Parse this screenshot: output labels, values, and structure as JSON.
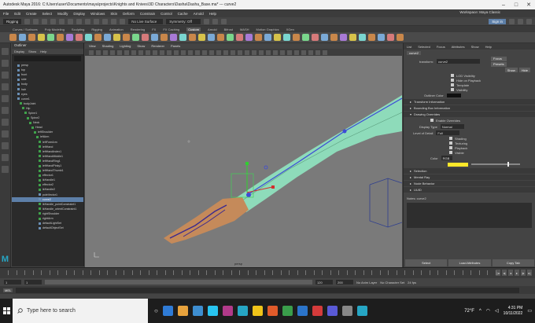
{
  "window": {
    "title": "Autodesk Maya 2016: C:\\Users\\user\\Documents\\maya\\projects\\Knights and Knives\\3D Characters\\Dasha\\Dasha_Base.ma* --- curve2",
    "controls": [
      "–",
      "□",
      "✕"
    ]
  },
  "menubar": {
    "items": [
      "File",
      "Edit",
      "Create",
      "Select",
      "Modify",
      "Display",
      "Windows",
      "Skin",
      "Deform",
      "Constrain",
      "Control",
      "Cache",
      "Arnold",
      "Help"
    ],
    "workspace": "Workspace: Maya Classic"
  },
  "statusline": {
    "menu_set": "Rigging",
    "search_value": "No Live Surface",
    "symmetry": "Symmetry: Off",
    "sign_in": "Sign in"
  },
  "shelf_tabs": {
    "items": [
      "Curves / Surfaces",
      "Poly Modeling",
      "Sculpting",
      "Rigging",
      "Animation",
      "Rendering",
      "FX",
      "FX Caching",
      "Custom",
      "Arnold",
      "Bifrost",
      "MASH",
      "Motion Graphics",
      "XGen"
    ],
    "active_index": 8
  },
  "outliner": {
    "title": "Outliner",
    "menu": [
      "Display",
      "Show",
      "Help"
    ],
    "items": [
      {
        "label": "persp",
        "type": "cam"
      },
      {
        "label": "top",
        "type": "cam"
      },
      {
        "label": "front",
        "type": "cam"
      },
      {
        "label": "side",
        "type": "cam"
      },
      {
        "label": "body",
        "type": "mesh"
      },
      {
        "label": "hair",
        "type": "mesh"
      },
      {
        "label": "eyes",
        "type": "mesh"
      },
      {
        "label": "curve1",
        "type": "mesh"
      },
      {
        "label": "bodyJoint",
        "type": "joint"
      },
      {
        "label": "Hip",
        "type": "joint"
      },
      {
        "label": "Spine1",
        "type": "joint"
      },
      {
        "label": "Spine2",
        "type": "joint"
      },
      {
        "label": "Neck",
        "type": "joint"
      },
      {
        "label": "Head",
        "type": "joint"
      },
      {
        "label": "leftShoulder",
        "type": "joint"
      },
      {
        "label": "leftArm",
        "type": "joint"
      },
      {
        "label": "leftForeArm",
        "type": "joint"
      },
      {
        "label": "leftHand",
        "type": "joint"
      },
      {
        "label": "leftHandIndex1",
        "type": "joint"
      },
      {
        "label": "leftHandMiddle1",
        "type": "joint"
      },
      {
        "label": "leftHandRing1",
        "type": "joint"
      },
      {
        "label": "leftHandPinky1",
        "type": "joint"
      },
      {
        "label": "leftHandThumb1",
        "type": "joint"
      },
      {
        "label": "effector1",
        "type": "joint"
      },
      {
        "label": "ikHandle1",
        "type": "joint"
      },
      {
        "label": "effector2",
        "type": "joint"
      },
      {
        "label": "ikHandle2",
        "type": "joint"
      },
      {
        "label": "poleVector1",
        "type": "mesh"
      },
      {
        "label": "curve2",
        "type": "mesh"
      },
      {
        "label": "ikHandle_pointConstraint1",
        "type": "joint"
      },
      {
        "label": "ikHandle_orientConstraint1",
        "type": "joint"
      },
      {
        "label": "rightShoulder",
        "type": "joint"
      },
      {
        "label": "rightArm",
        "type": "joint"
      },
      {
        "label": "defaultLightSet",
        "type": "mesh"
      },
      {
        "label": "defaultObjectSet",
        "type": "mesh"
      }
    ],
    "selected_index": 28
  },
  "viewport": {
    "menu": [
      "View",
      "Shading",
      "Lighting",
      "Show",
      "Renderer",
      "Panels"
    ],
    "camera_label": "persp",
    "joint_color": "#3d4bd6",
    "mesh_color": "#8fe3bf",
    "hand_color": "#c58a5a"
  },
  "attribute_editor": {
    "tabs": [
      "List",
      "Selected",
      "Focus",
      "Attributes",
      "Show",
      "Help"
    ],
    "node_tab": "curve2",
    "transform_label": "transform:",
    "transform_value": "curve2",
    "focus_button": "Focus",
    "presets_button": "Presets",
    "show_button": "Show",
    "hide_button": "Hide",
    "sections": [
      {
        "label": "Transform Attributes",
        "open": false
      },
      {
        "label": "Pivots",
        "open": false
      },
      {
        "label": "Limit Information",
        "open": false
      },
      {
        "label": "Display",
        "open": true
      }
    ],
    "display_checks": [
      "LOD Visibility",
      "Hide on Playback",
      "Template",
      "Visibility"
    ],
    "outliner_color_label": "Outliner Color",
    "sections2": [
      {
        "label": "Transform Information",
        "open": false
      },
      {
        "label": "Bounding Box Information",
        "open": false
      },
      {
        "label": "Drawing Overrides",
        "open": true
      }
    ],
    "enable_overrides": "Enable Overrides",
    "display_type_label": "Display Type",
    "display_type_value": "Normal",
    "level_of_detail_label": "Level of Detail",
    "level_of_detail_value": "Full",
    "override_checks": [
      "Shading",
      "Texturing",
      "Playback",
      "Visible"
    ],
    "color_label": "Color",
    "color_mode": "RGB",
    "override_color": "#ffe82a",
    "sections3": [
      {
        "label": "Selection",
        "open": false
      },
      {
        "label": "Mental Ray",
        "open": false
      },
      {
        "label": "Node Behavior",
        "open": false
      },
      {
        "label": "UUID",
        "open": false
      }
    ],
    "notes_label": "Notes: curve2",
    "bottom_buttons": [
      "Select",
      "Load Attributes",
      "Copy Tab"
    ]
  },
  "timeline": {
    "start": "1",
    "end": "120",
    "range_end": "200",
    "range_start": "1",
    "anim_layer": "No Anim Layer",
    "char_set": "No Character Set",
    "fps": "24 fps",
    "current": "1"
  },
  "command_line": {
    "mode": "MEL"
  },
  "taskbar": {
    "search_placeholder": "Type here to search",
    "time": "4:31 PM",
    "date": "10/11/2022",
    "temperature": "72°F",
    "app_colors": [
      "#2f7bd6",
      "#e8a33d",
      "#3e8ed0",
      "#28c4f0",
      "#b23a8a",
      "#26a6c4",
      "#f0c419",
      "#e15b2a",
      "#3a9e4b",
      "#2b74c9",
      "#d43b3b",
      "#5a5ad6",
      "#888888",
      "#26a6c4"
    ]
  }
}
